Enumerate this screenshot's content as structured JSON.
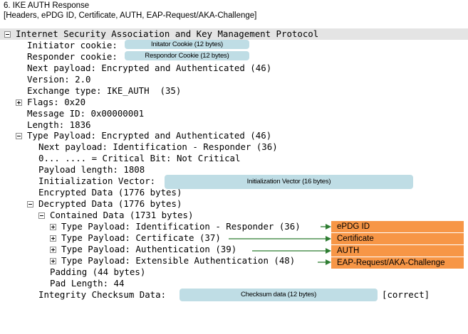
{
  "caption": {
    "line1": "6. IKE AUTH Response",
    "line2": "[Headers, ePDG ID, Certificate, AUTH, EAP-Request/AKA-Challenge]"
  },
  "tree": {
    "root": "Internet Security Association and Key Management Protocol",
    "initiator_cookie_label": "Initiator cookie:",
    "responder_cookie_label": "Responder cookie:",
    "next_payload": "Next payload: Encrypted and Authenticated (46)",
    "version": "Version: 2.0",
    "exchange_type": "Exchange type: IKE_AUTH  (35)",
    "flags": "Flags: 0x20",
    "message_id": "Message ID: 0x00000001",
    "length": "Length: 1836",
    "type_payload": "Type Payload: Encrypted and Authenticated (46)",
    "tp_next_payload": "Next payload: Identification - Responder (36)",
    "critical_bit": "0... .... = Critical Bit: Not Critical",
    "payload_length": "Payload length: 1808",
    "init_vector_label": "Initialization Vector:",
    "encrypted_data": "Encrypted Data (1776 bytes)",
    "decrypted_data": "Decrypted Data (1776 bytes)",
    "contained_data": "Contained Data (1731 bytes)",
    "tp_identification": "Type Payload: Identification - Responder (36)",
    "tp_certificate": "Type Payload: Certificate (37)",
    "tp_authentication": "Type Payload: Authentication (39)",
    "tp_eap": "Type Payload: Extensible Authentication (48)",
    "padding": "Padding (44 bytes)",
    "pad_length": "Pad Length: 44",
    "integrity_label": "Integrity Checksum Data:",
    "integrity_status": "[correct]"
  },
  "masked": {
    "initiator_cookie": "Initator Cookie (12 bytes)",
    "responder_cookie": "Respondor Cookie (12 bytes)",
    "init_vector": "Initialization Vector (16 bytes)",
    "checksum": "Checksum data (12 bytes)"
  },
  "callouts": {
    "epdg_id": "ePDG ID",
    "certificate": "Certificate",
    "auth": "AUTH",
    "eap": "EAP-Request/AKA-Challenge"
  },
  "colors": {
    "mask_fill": "#bfdde5",
    "callout_fill": "#f79646",
    "arrow": "#2e7d32",
    "root_bar": "#e4e4e4"
  }
}
